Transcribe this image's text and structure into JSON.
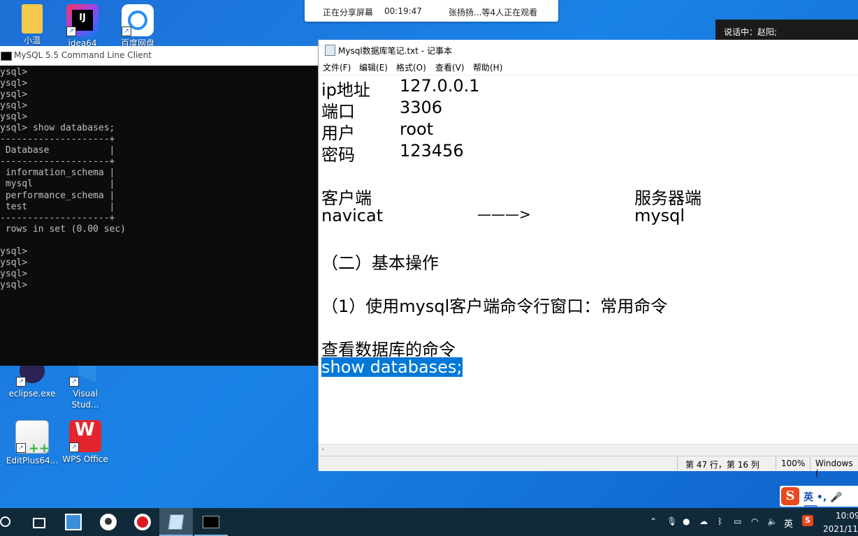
{
  "desktop": {
    "icons": [
      {
        "label": "小温"
      },
      {
        "label": "idea64"
      },
      {
        "label": "百度网盘"
      },
      {
        "label": "eclipse.exe"
      },
      {
        "label": "Visual Stud..."
      },
      {
        "label": "EditPlus64..."
      },
      {
        "label": "WPS Office"
      }
    ]
  },
  "sharebar": {
    "status": "正在分享屏幕",
    "time": "00:19:47",
    "viewers": "张扬扬...等4人正在观看"
  },
  "talkbar": {
    "text": "说话中：赵阳;"
  },
  "console": {
    "title": "MySQL 5.5 Command Line Client",
    "lines": [
      "ysql>",
      "ysql>",
      "ysql>",
      "ysql>",
      "ysql>",
      "ysql> show databases;",
      "--------------------+",
      " Database           |",
      "--------------------+",
      " information_schema |",
      " mysql              |",
      " performance_schema |",
      " test               |",
      "--------------------+",
      " rows in set (0.00 sec)",
      "",
      "ysql>",
      "ysql>",
      "ysql>",
      "ysql>"
    ]
  },
  "notepad": {
    "title": "Mysql数据库笔记.txt - 记事本",
    "menu": [
      "文件(F)",
      "编辑(E)",
      "格式(O)",
      "查看(V)",
      "帮助(H)"
    ],
    "content": {
      "ip_label": "ip地址",
      "ip_value": "127.0.0.1",
      "port_label": "端口",
      "port_value": "3306",
      "user_label": "用户",
      "user_value": "root",
      "pwd_label": "密码",
      "pwd_value": "123456",
      "client_label": "客户端",
      "server_label": "服务器端",
      "client_value": "navicat",
      "arrow": "———>",
      "server_value": "mysql",
      "section2": "（二）基本操作",
      "item1": "（1）使用mysql客户端命令行窗口：常用命令",
      "cmd_title": "查看数据库的命令",
      "cmd_selected": "show databases;"
    },
    "status": {
      "position": "第 47 行，第 16 列",
      "zoom": "100%",
      "encoding": "Windows ("
    }
  },
  "ime": {
    "logo": "S",
    "text": "英 •, 🎤 ⌨"
  },
  "taskbar": {
    "clock_time": "10:09",
    "clock_date": "2021/11/",
    "lang": "英"
  }
}
